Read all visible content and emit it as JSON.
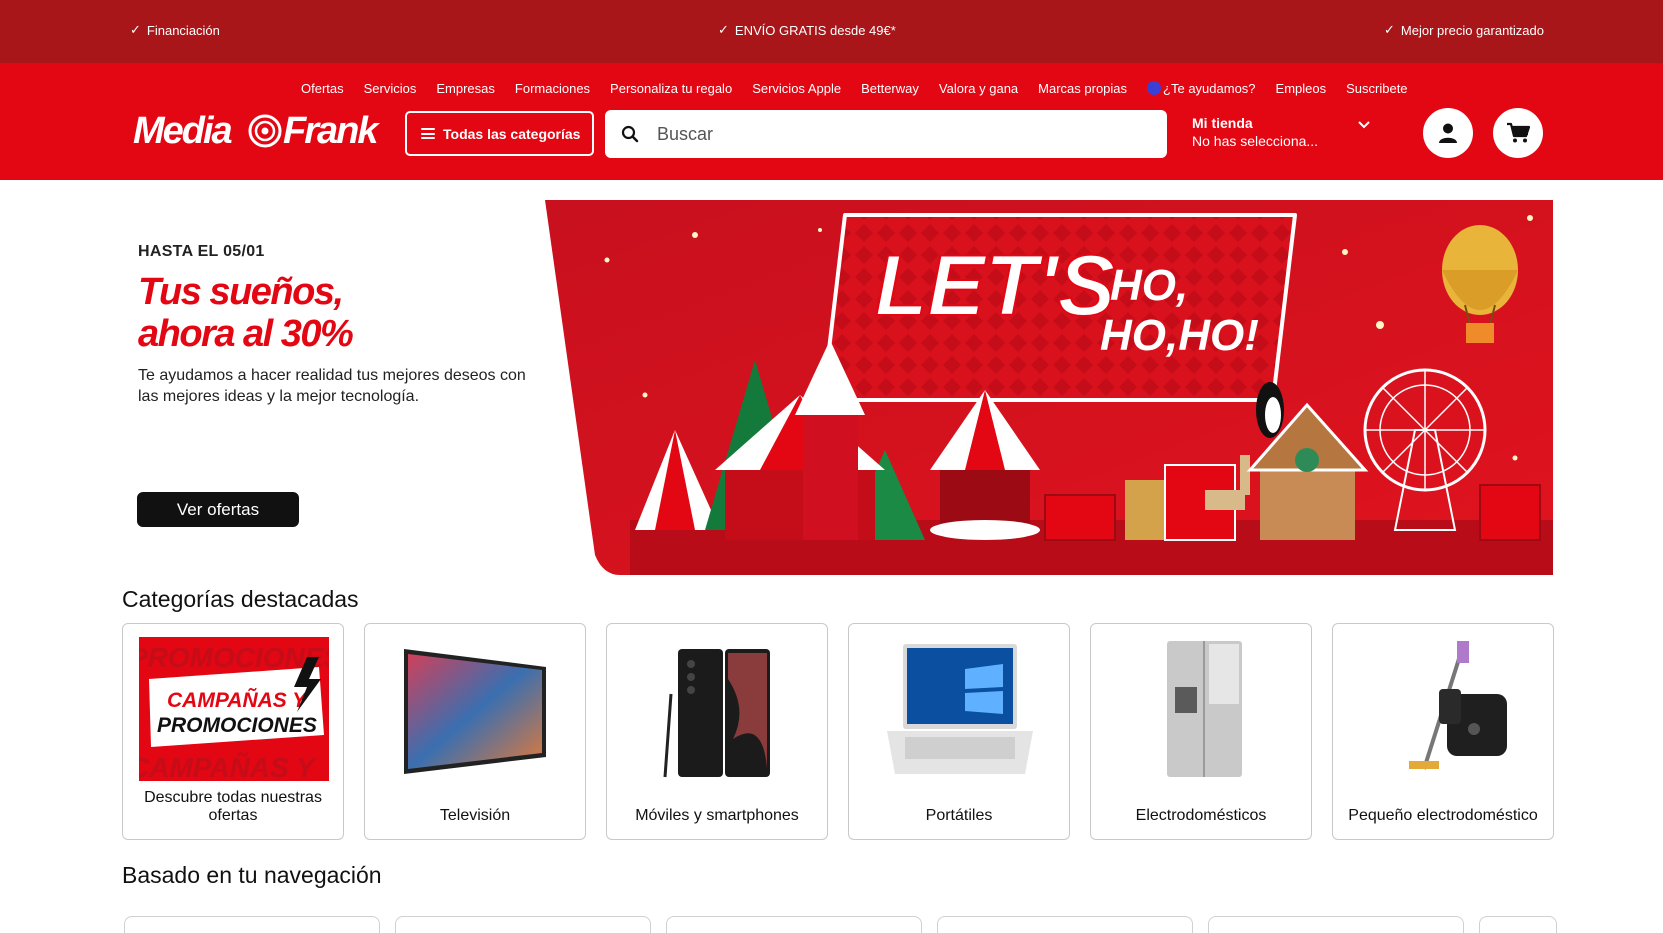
{
  "promo_bar": {
    "items": [
      {
        "icon": "check-icon",
        "label": "Financiación"
      },
      {
        "icon": "check-icon",
        "label": "ENVÍO GRATIS desde 49€*"
      },
      {
        "icon": "check-icon",
        "label": "Mejor precio garantizado"
      }
    ]
  },
  "header": {
    "nav": [
      "Ofertas",
      "Servicios",
      "Empresas",
      "Formaciones",
      "Personaliza tu regalo",
      "Servicios Apple",
      "Betterway",
      "Valora y gana",
      "Marcas propias",
      "¿Te ayudamos?",
      "Empleos",
      "Suscribete"
    ],
    "logo_text": "MediaFrank",
    "categories_button": "Todas las categorías",
    "search_placeholder": "Buscar",
    "store_title": "Mi tienda",
    "store_value": "No has selecciona...",
    "brand_color": "#e30613",
    "promo_bar_color": "#a81619"
  },
  "hero": {
    "date": "HASTA EL 05/01",
    "title_line1": "Tus sueños,",
    "title_line2": "ahora al 30%",
    "subtitle": "Te ayudamos a hacer realidad tus mejores deseos con las mejores ideas y la mejor tecnología.",
    "cta": "Ver ofertas",
    "banner_line1": "LET'S",
    "banner_line2": "HO,",
    "banner_line3": "HO,HO!"
  },
  "featured": {
    "title": "Categorías destacadas",
    "items": [
      {
        "label": "Descubre todas nuestras ofertas",
        "image": "campaigns-promo-image",
        "image_text_1": "CAMPAÑAS Y",
        "image_text_2": "PROMOCIONES"
      },
      {
        "label": "Televisión",
        "image": "tv-image"
      },
      {
        "label": "Móviles y smartphones",
        "image": "smartphone-image"
      },
      {
        "label": "Portátiles",
        "image": "laptop-image"
      },
      {
        "label": "Electrodomésticos",
        "image": "fridge-image"
      },
      {
        "label": "Pequeño electrodoméstico",
        "image": "small-appliance-image"
      }
    ]
  },
  "browsing": {
    "title": "Basado en tu navegación"
  }
}
